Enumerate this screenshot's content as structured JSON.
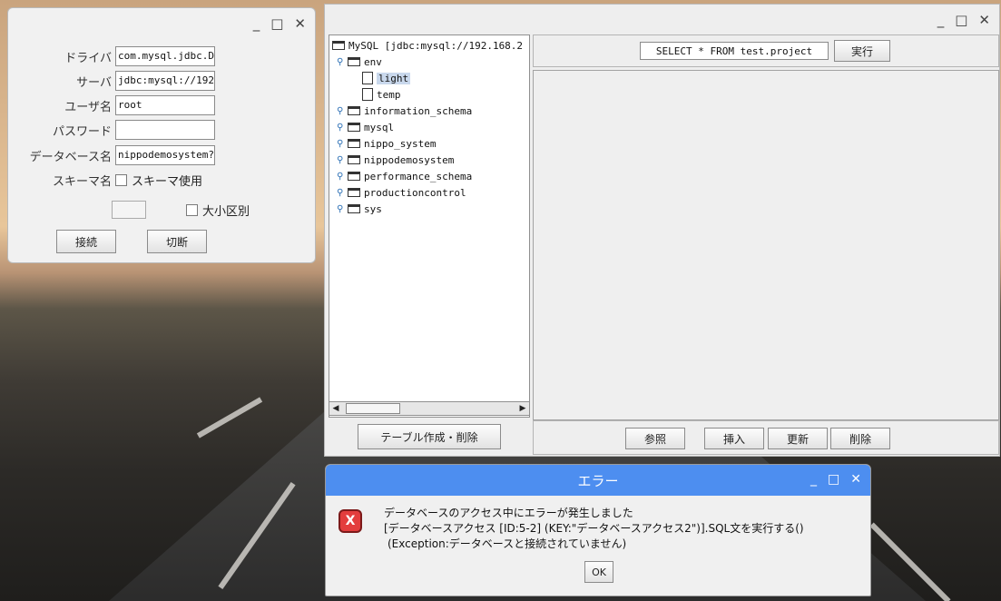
{
  "connection_window": {
    "controls": {
      "minimize": "_",
      "maximize": "□",
      "close": "✕"
    },
    "fields": {
      "driver_label": "ドライバ",
      "driver_value": "com.mysql.jdbc.D",
      "server_label": "サーバ",
      "server_value": "jdbc:mysql://192",
      "user_label": "ユーザ名",
      "user_value": "root",
      "password_label": "パスワード",
      "password_value": "",
      "database_label": "データベース名",
      "database_value": "nippodemosystem?u",
      "schema_label": "スキーマ名",
      "schema_checkbox_label": "スキーマ使用",
      "case_checkbox_label": "大小区別"
    },
    "buttons": {
      "connect": "接続",
      "disconnect": "切断"
    }
  },
  "main_window": {
    "controls": {
      "minimize": "_",
      "maximize": "□",
      "close": "✕"
    },
    "tree": {
      "root": "MySQL [jdbc:mysql://192.168.2",
      "nodes": [
        {
          "label": "env",
          "type": "folder",
          "expanded": true,
          "level": 1
        },
        {
          "label": "light",
          "type": "file",
          "selected": true,
          "level": 2
        },
        {
          "label": "temp",
          "type": "file",
          "level": 2
        },
        {
          "label": "information_schema",
          "type": "folder",
          "level": 1
        },
        {
          "label": "mysql",
          "type": "folder",
          "level": 1
        },
        {
          "label": "nippo_system",
          "type": "folder",
          "level": 1
        },
        {
          "label": "nippodemosystem",
          "type": "folder",
          "level": 1
        },
        {
          "label": "performance_schema",
          "type": "folder",
          "level": 1
        },
        {
          "label": "productioncontrol",
          "type": "folder",
          "level": 1
        },
        {
          "label": "sys",
          "type": "folder",
          "level": 1
        }
      ]
    },
    "sql_input": "SELECT * FROM test.project",
    "execute_button": "実行",
    "table_button": "テーブル作成・削除",
    "action_buttons": {
      "browse": "参照",
      "insert": "挿入",
      "update": "更新",
      "delete": "削除"
    }
  },
  "error_dialog": {
    "title": "エラー",
    "icon": "error-icon",
    "controls": {
      "minimize": "_",
      "maximize": "□",
      "close": "✕"
    },
    "line1": "データベースのアクセス中にエラーが発生しました",
    "line2": "[データベースアクセス [ID:5-2] (KEY:\"データベースアクセス2\")].SQL文を実行する()",
    "line3": "(Exception:データベースと接続されていません)",
    "ok_button": "OK"
  }
}
